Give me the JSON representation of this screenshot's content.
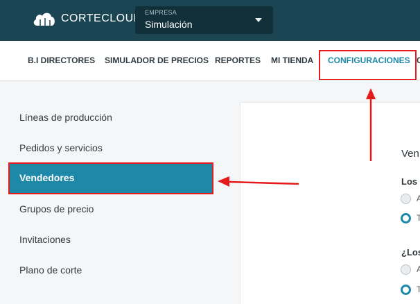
{
  "header": {
    "logo_text": "CORTECLOUD",
    "company_label": "EMPRESA",
    "company_value": "Simulación"
  },
  "nav": {
    "items": [
      {
        "label": "B.I DIRECTORES"
      },
      {
        "label": "SIMULADOR DE PRECIOS"
      },
      {
        "label": "REPORTES"
      },
      {
        "label": "MI TIENDA"
      },
      {
        "label": "CONFIGURACIONES",
        "active": true
      },
      {
        "label": "C"
      }
    ]
  },
  "sidebar": {
    "items": [
      {
        "label": "Líneas de producción"
      },
      {
        "label": "Pedidos y servicios"
      },
      {
        "label": "Vendedores",
        "active": true
      },
      {
        "label": "Grupos de precio"
      },
      {
        "label": "Invitaciones"
      },
      {
        "label": "Plano de corte"
      }
    ]
  },
  "panel": {
    "title": "Ven",
    "questions": [
      {
        "label": "Los v",
        "options": [
          {
            "label": "A",
            "selected": false
          },
          {
            "label": "T",
            "selected": true
          }
        ]
      },
      {
        "label": "¿Los",
        "options": [
          {
            "label": "A",
            "selected": false
          },
          {
            "label": "T",
            "selected": true
          }
        ]
      }
    ]
  },
  "colors": {
    "topbar": "#1b4552",
    "accent": "#1e88a8",
    "annotation": "#e51b1b"
  }
}
